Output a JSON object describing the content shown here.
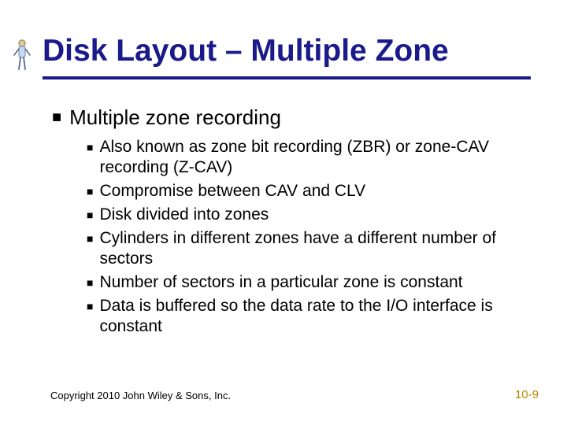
{
  "title": "Disk Layout – Multiple Zone",
  "bullets_l1": [
    {
      "text": "Multiple zone recording"
    }
  ],
  "bullets_l2": [
    {
      "text": "Also known as zone bit recording (ZBR) or zone-CAV recording (Z-CAV)"
    },
    {
      "text": "Compromise between CAV and CLV"
    },
    {
      "text": "Disk divided into zones"
    },
    {
      "text": "Cylinders in different zones have a different number of sectors"
    },
    {
      "text": "Number of sectors in a particular zone is constant"
    },
    {
      "text": "Data is buffered so the data rate to the I/O interface is constant"
    }
  ],
  "footer": {
    "copyright": "Copyright 2010 John Wiley & Sons, Inc.",
    "page": "10-9"
  }
}
